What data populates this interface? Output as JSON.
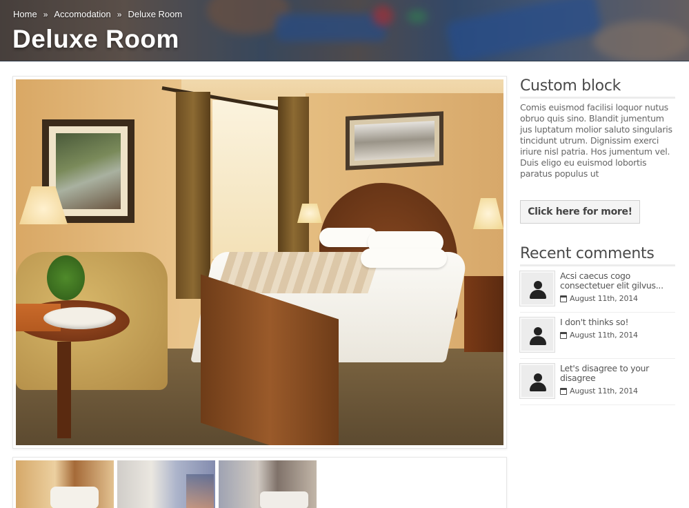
{
  "breadcrumb": {
    "items": [
      "Home",
      "Accomodation",
      "Deluxe Room"
    ],
    "separator": "»"
  },
  "page": {
    "title": "Deluxe Room"
  },
  "main_image": {
    "alt": "deluxe-room-photo"
  },
  "thumbnails": [
    "room-thumb-1",
    "room-thumb-2",
    "room-thumb-3"
  ],
  "sidebar": {
    "custom_block": {
      "title": "Custom block",
      "text": "Comis euismod facilisi loquor nutus obruo quis sino. Blandit jumentum jus luptatum molior saluto singularis tincidunt utrum. Dignissim exerci iriure nisl patria. Hos jumentum vel. Duis eligo eu euismod lobortis paratus populus ut",
      "button_label": "Click here for more!"
    },
    "recent_comments": {
      "title": "Recent comments",
      "items": [
        {
          "text": "Acsi caecus cogo consectetuer elit gilvus...",
          "date": "August 11th, 2014"
        },
        {
          "text": "I don't thinks so!",
          "date": "August 11th, 2014"
        },
        {
          "text": "Let's disagree to your disagree",
          "date": "August 11th, 2014"
        }
      ]
    }
  },
  "icons": {
    "avatar": "user-avatar-icon",
    "date": "calendar-icon"
  }
}
